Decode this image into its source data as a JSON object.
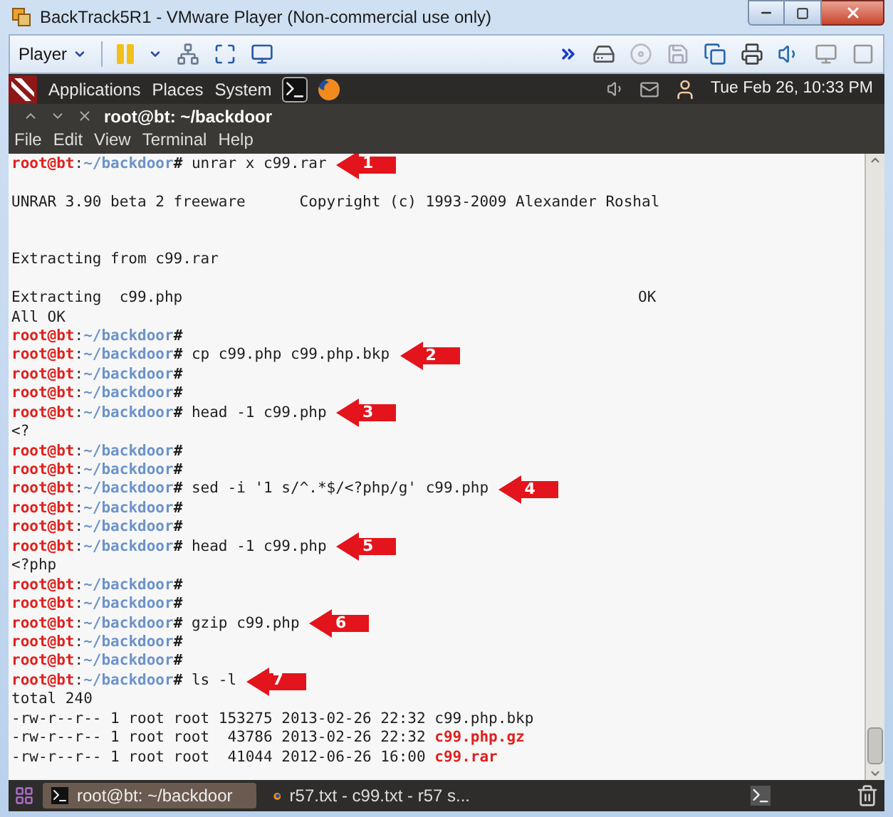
{
  "window": {
    "title": "BackTrack5R1 - VMware Player (Non-commercial use only)"
  },
  "toolbar": {
    "menu": "Player"
  },
  "panel": {
    "menus": [
      "Applications",
      "Places",
      "System"
    ],
    "clock": "Tue Feb 26, 10:33 PM"
  },
  "terminal": {
    "title": "root@bt: ~/backdoor",
    "menus": [
      "File",
      "Edit",
      "View",
      "Terminal",
      "Help"
    ],
    "lines": [
      {
        "kind": "prompt",
        "user": "root@bt",
        "separator": ":",
        "path": "~/backdoor",
        "symbol": "#",
        "command": "unrar x c99.rar",
        "step": "1"
      },
      {
        "kind": "blank"
      },
      {
        "kind": "text",
        "text": "UNRAR 3.90 beta 2 freeware      Copyright (c) 1993-2009 Alexander Roshal"
      },
      {
        "kind": "blank"
      },
      {
        "kind": "blank"
      },
      {
        "kind": "text",
        "text": "Extracting from c99.rar"
      },
      {
        "kind": "blank"
      },
      {
        "kind": "progress",
        "text": "Extracting  c99.php",
        "status": "OK"
      },
      {
        "kind": "text",
        "text": "All OK"
      },
      {
        "kind": "prompt",
        "user": "root@bt",
        "separator": ":",
        "path": "~/backdoor",
        "symbol": "#"
      },
      {
        "kind": "prompt",
        "user": "root@bt",
        "separator": ":",
        "path": "~/backdoor",
        "symbol": "#",
        "command": "cp c99.php c99.php.bkp",
        "step": "2"
      },
      {
        "kind": "prompt",
        "user": "root@bt",
        "separator": ":",
        "path": "~/backdoor",
        "symbol": "#"
      },
      {
        "kind": "prompt",
        "user": "root@bt",
        "separator": ":",
        "path": "~/backdoor",
        "symbol": "#"
      },
      {
        "kind": "prompt",
        "user": "root@bt",
        "separator": ":",
        "path": "~/backdoor",
        "symbol": "#",
        "command": "head -1 c99.php",
        "step": "3"
      },
      {
        "kind": "text",
        "text": "<?"
      },
      {
        "kind": "prompt",
        "user": "root@bt",
        "separator": ":",
        "path": "~/backdoor",
        "symbol": "#"
      },
      {
        "kind": "prompt",
        "user": "root@bt",
        "separator": ":",
        "path": "~/backdoor",
        "symbol": "#"
      },
      {
        "kind": "prompt",
        "user": "root@bt",
        "separator": ":",
        "path": "~/backdoor",
        "symbol": "#",
        "command": "sed -i '1 s/^.*$/<?php/g' c99.php",
        "step": "4"
      },
      {
        "kind": "prompt",
        "user": "root@bt",
        "separator": ":",
        "path": "~/backdoor",
        "symbol": "#"
      },
      {
        "kind": "prompt",
        "user": "root@bt",
        "separator": ":",
        "path": "~/backdoor",
        "symbol": "#"
      },
      {
        "kind": "prompt",
        "user": "root@bt",
        "separator": ":",
        "path": "~/backdoor",
        "symbol": "#",
        "command": "head -1 c99.php",
        "step": "5"
      },
      {
        "kind": "text",
        "text": "<?php"
      },
      {
        "kind": "prompt",
        "user": "root@bt",
        "separator": ":",
        "path": "~/backdoor",
        "symbol": "#"
      },
      {
        "kind": "prompt",
        "user": "root@bt",
        "separator": ":",
        "path": "~/backdoor",
        "symbol": "#"
      },
      {
        "kind": "prompt",
        "user": "root@bt",
        "separator": ":",
        "path": "~/backdoor",
        "symbol": "#",
        "command": "gzip c99.php",
        "step": "6"
      },
      {
        "kind": "prompt",
        "user": "root@bt",
        "separator": ":",
        "path": "~/backdoor",
        "symbol": "#"
      },
      {
        "kind": "prompt",
        "user": "root@bt",
        "separator": ":",
        "path": "~/backdoor",
        "symbol": "#"
      },
      {
        "kind": "prompt",
        "user": "root@bt",
        "separator": ":",
        "path": "~/backdoor",
        "symbol": "#",
        "command": "ls -l",
        "step": "7"
      },
      {
        "kind": "text",
        "text": "total 240"
      },
      {
        "kind": "file",
        "info": "-rw-r--r-- 1 root root 153275 2013-02-26 22:32",
        "name": "c99.php.bkp",
        "archive": false
      },
      {
        "kind": "file",
        "info": "-rw-r--r-- 1 root root  43786 2013-02-26 22:32",
        "name": "c99.php.gz",
        "archive": true
      },
      {
        "kind": "file",
        "info": "-rw-r--r-- 1 root root  41044 2012-06-26 16:00",
        "name": "c99.rar",
        "archive": true
      }
    ]
  },
  "taskbar": {
    "tasks": [
      {
        "kind": "terminal",
        "label": "root@bt: ~/backdoor",
        "selected": true
      },
      {
        "kind": "browser",
        "label": "r57.txt - c99.txt - r57 s...",
        "selected": false
      }
    ]
  }
}
